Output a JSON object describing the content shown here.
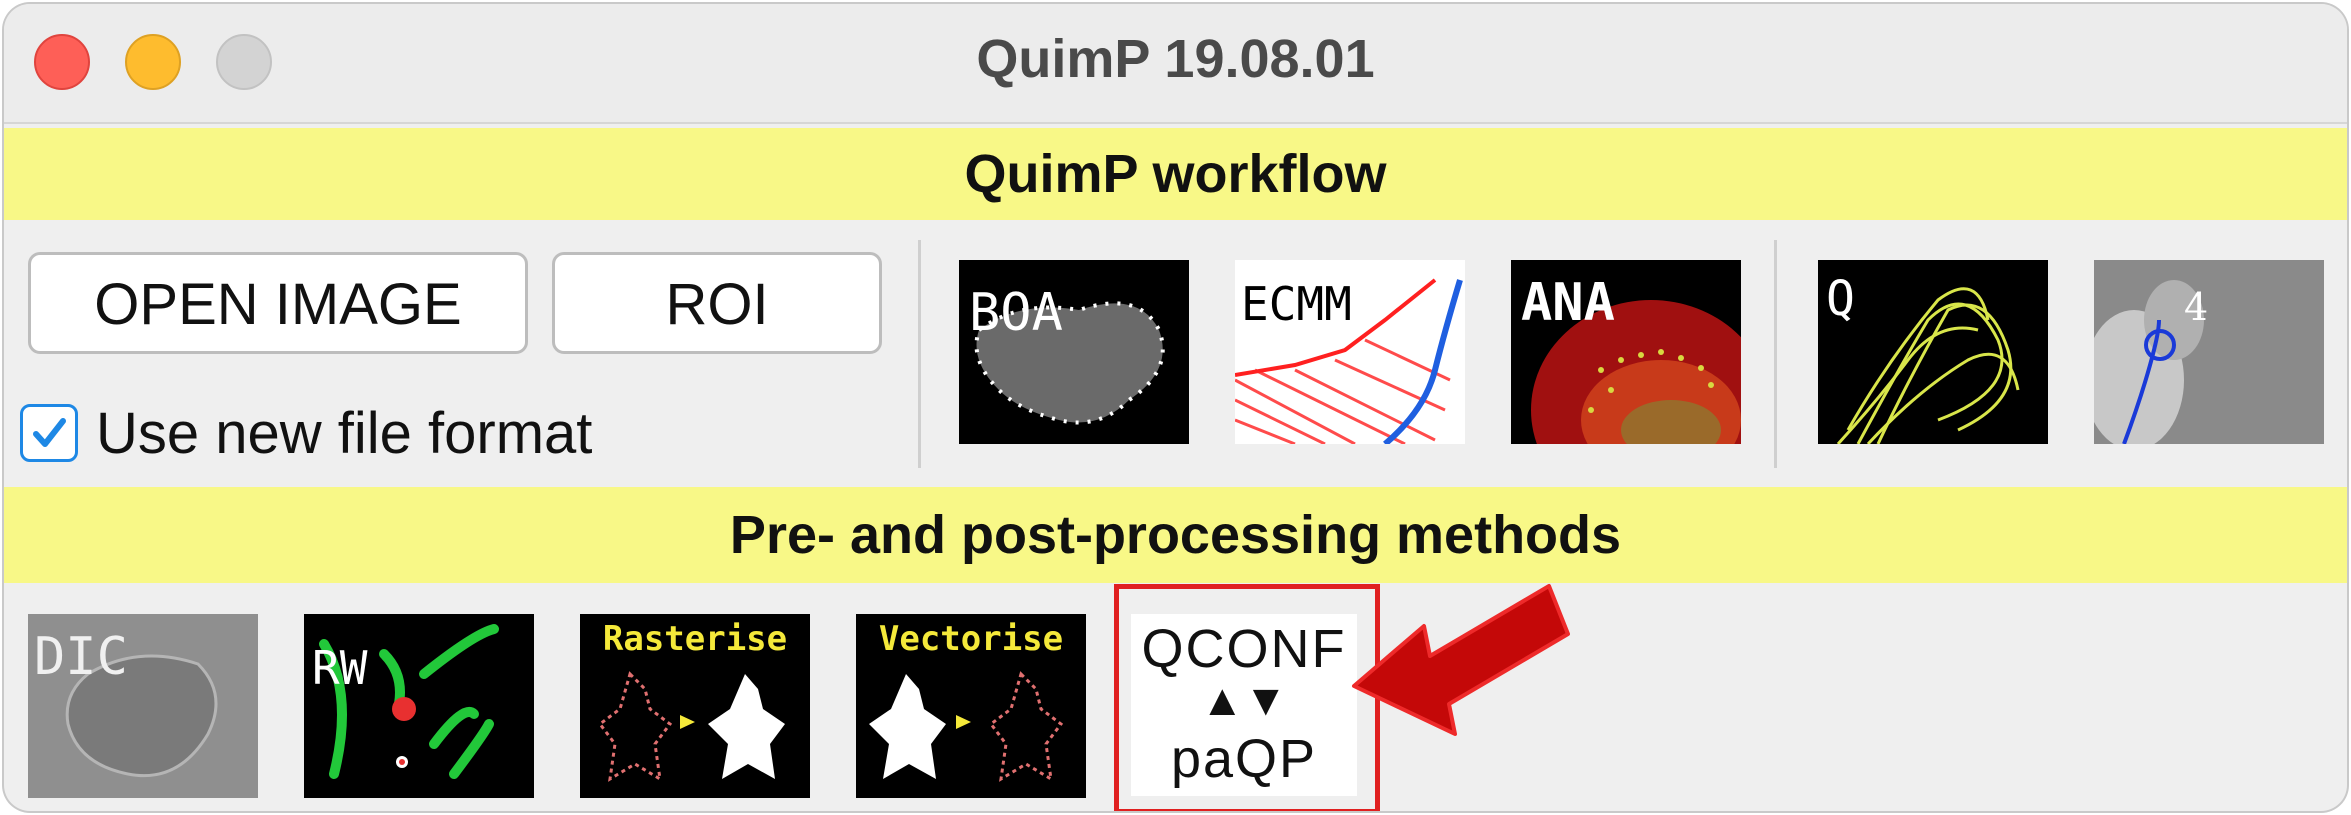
{
  "window": {
    "title": "QuimP 19.08.01"
  },
  "workflow": {
    "header": "QuimP workflow",
    "buttons": {
      "open_image": "OPEN IMAGE",
      "roi": "ROI"
    },
    "use_new_format": {
      "label": "Use new file format",
      "checked": true
    },
    "tools": [
      {
        "icon": "boa-icon",
        "text": "BOA"
      },
      {
        "icon": "ecmm-icon",
        "text": "ECMM"
      },
      {
        "icon": "ana-icon",
        "text": "ANA"
      },
      {
        "icon": "q-icon",
        "text": "Q"
      },
      {
        "icon": "prot-analysis-icon",
        "text": "4"
      }
    ]
  },
  "processing": {
    "header": "Pre- and post-processing methods",
    "tools": [
      {
        "icon": "dic-icon",
        "text": "DIC"
      },
      {
        "icon": "random-walk-icon",
        "text": "RW"
      },
      {
        "icon": "rasterise-icon",
        "text": "Rasterise"
      },
      {
        "icon": "vectorise-icon",
        "text": "Vectorise"
      },
      {
        "icon": "qconf-converter-icon",
        "line1": "QCONF",
        "line2": "▲▼",
        "line3": "paQP"
      }
    ]
  },
  "colors": {
    "band": "#f8f887",
    "highlight": "#e02020",
    "checkbox_accent": "#1e88e5"
  }
}
